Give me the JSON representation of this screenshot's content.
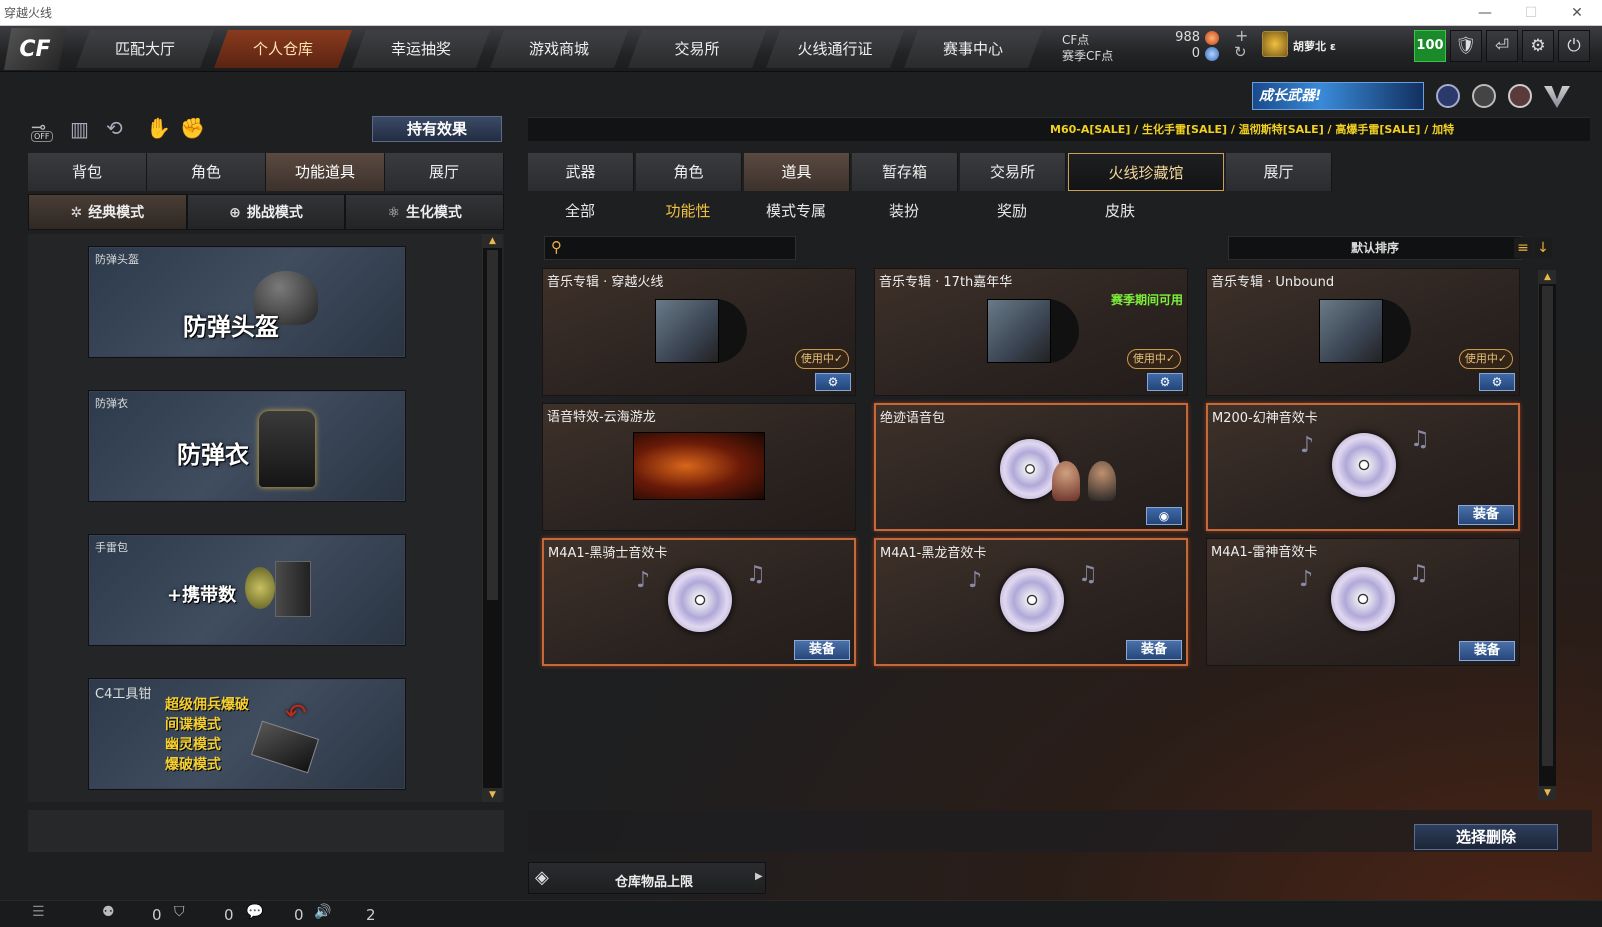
{
  "window": {
    "title": "穿越火线",
    "minimize": "—",
    "maximize": "☐",
    "close": "✕"
  },
  "logo": "CF",
  "nav": {
    "tabs": [
      "匹配大厅",
      "个人仓库",
      "幸运抽奖",
      "游戏商城",
      "交易所",
      "火线通行证",
      "赛事中心"
    ],
    "active": 1
  },
  "points": {
    "cf_label": "CF点",
    "cf_value": "988",
    "season_label": "赛季CF点",
    "season_value": "0",
    "plus": "+",
    "refresh": "↻"
  },
  "user": {
    "name": "胡萝北 ε",
    "level": "100"
  },
  "icons": {
    "shield": "🛡",
    "exit": "⏎",
    "gear": "⚙",
    "power": "⏻"
  },
  "banner": {
    "text": "成长武器!",
    "ticker": "M60-A[SALE] / 生化手雷[SALE] / 温彻斯特[SALE] / 高爆手雷[SALE] / 加特"
  },
  "left": {
    "off_label": "OFF",
    "effect_button": "持有效果",
    "tabs": [
      "背包",
      "角色",
      "功能道具",
      "展厅"
    ],
    "active_tab": 2,
    "modes": [
      "经典模式",
      "挑战模式",
      "生化模式"
    ],
    "active_mode": 0,
    "cards": [
      {
        "title": "防弹头盔",
        "big": "防弹头盔"
      },
      {
        "title": "防弹衣",
        "big": "防弹衣"
      },
      {
        "title": "手雷包",
        "big": "+携带数"
      },
      {
        "title": "C4工具钳",
        "lines": [
          "超级佣兵爆破",
          "间谍模式",
          "幽灵模式",
          "爆破模式"
        ]
      }
    ]
  },
  "right": {
    "tabs": [
      "武器",
      "角色",
      "道具",
      "暂存箱",
      "交易所",
      "火线珍藏馆",
      "展厅"
    ],
    "active_tab": 2,
    "subtabs": [
      "全部",
      "功能性",
      "模式专属",
      "装扮",
      "奖励",
      "皮肤"
    ],
    "active_sub": 1,
    "search_placeholder": "",
    "sort_label": "默认排序",
    "items": [
      {
        "name": "音乐专辑 · 穿越火线",
        "status": "使用中✓",
        "tag": ""
      },
      {
        "name": "音乐专辑 · 17th嘉年华",
        "status": "使用中✓",
        "tag": "赛季期间可用"
      },
      {
        "name": "音乐专辑 · Unbound",
        "status": "使用中✓",
        "tag": ""
      },
      {
        "name": "语音特效-云海游龙",
        "status": "",
        "tag": ""
      },
      {
        "name": "绝迹语音包",
        "status": "",
        "tag": ""
      },
      {
        "name": "M200-幻神音效卡",
        "status": "装备",
        "tag": ""
      },
      {
        "name": "M4A1-黑骑士音效卡",
        "status": "装备",
        "tag": ""
      },
      {
        "name": "M4A1-黑龙音效卡",
        "status": "装备",
        "tag": ""
      },
      {
        "name": "M4A1-雷神音效卡",
        "status": "装备",
        "tag": ""
      }
    ],
    "delete_button": "选择删除",
    "storage_label": "仓库物品上限"
  },
  "statusbar": {
    "counts": [
      "0",
      "0",
      "0",
      "2"
    ]
  }
}
